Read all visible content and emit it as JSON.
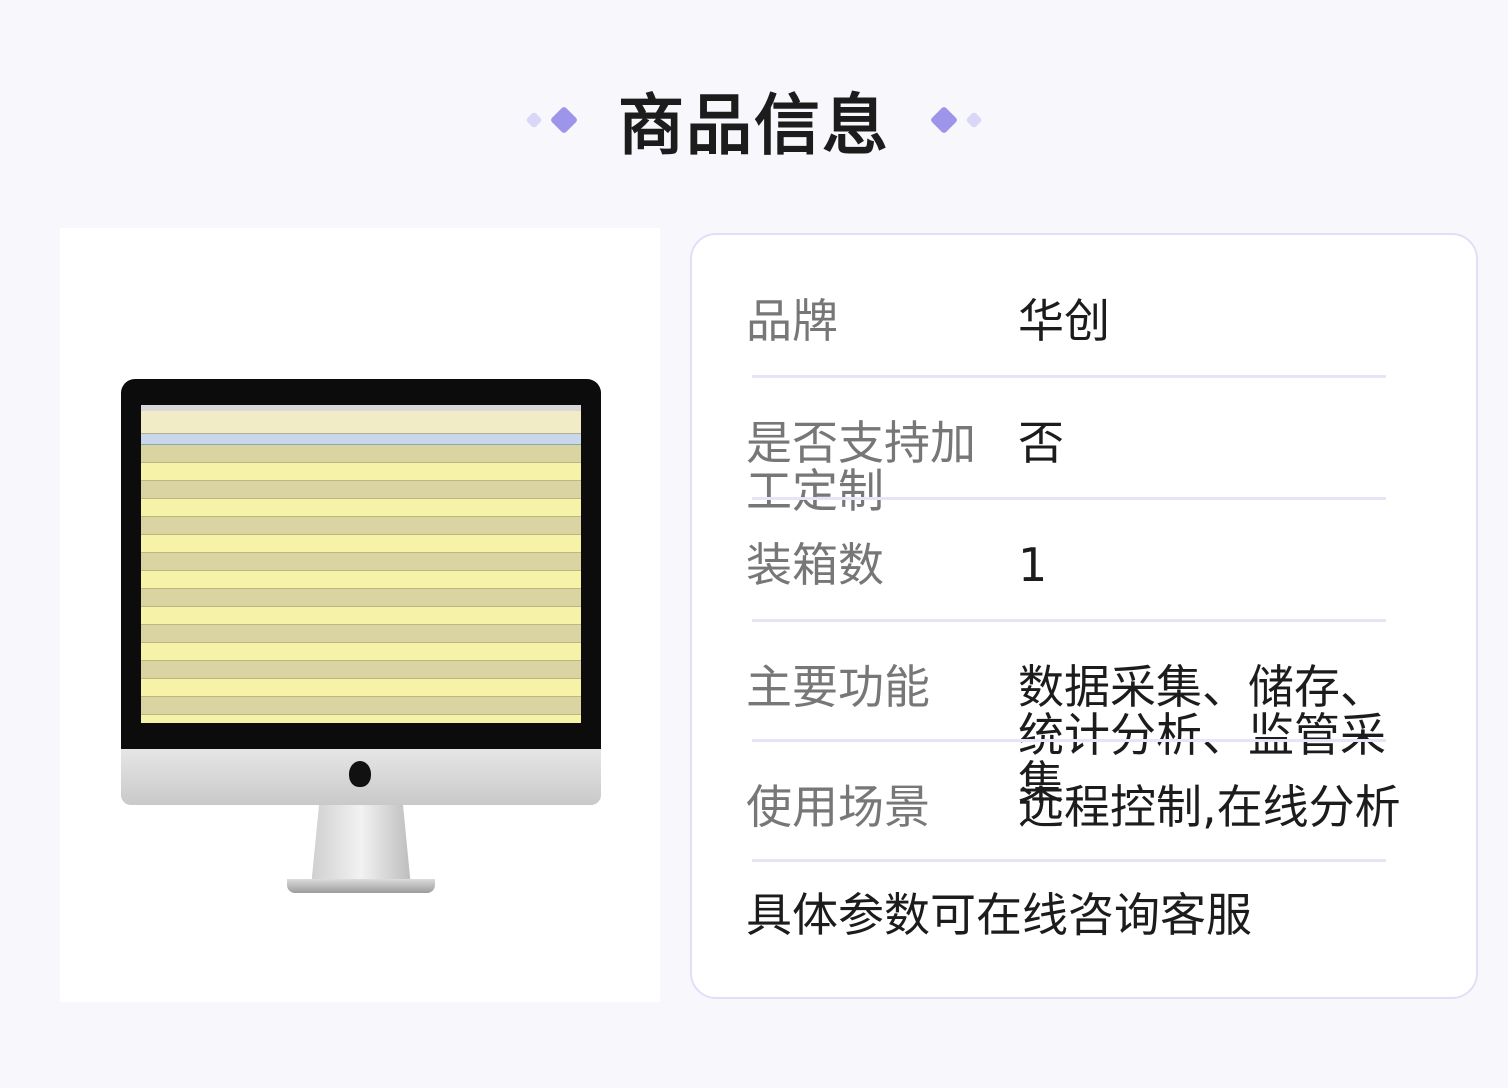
{
  "header": {
    "title": "商品信息"
  },
  "product_image": {
    "alt": "monitor-with-data-table"
  },
  "specs": [
    {
      "label": "品牌",
      "value": "华创"
    },
    {
      "label": "是否支持加工定制",
      "value": "否"
    },
    {
      "label": "装箱数",
      "value": "1"
    },
    {
      "label": "主要功能",
      "value": "数据采集、储存、统计分析、监管采集"
    },
    {
      "label": "使用场景",
      "value": "远程控制,在线分析"
    }
  ],
  "footnote": "具体参数可在线咨询客服",
  "colors": {
    "accent": "#9d95ea",
    "accent_light": "#d9d6f7",
    "card_border": "#e2def8"
  }
}
